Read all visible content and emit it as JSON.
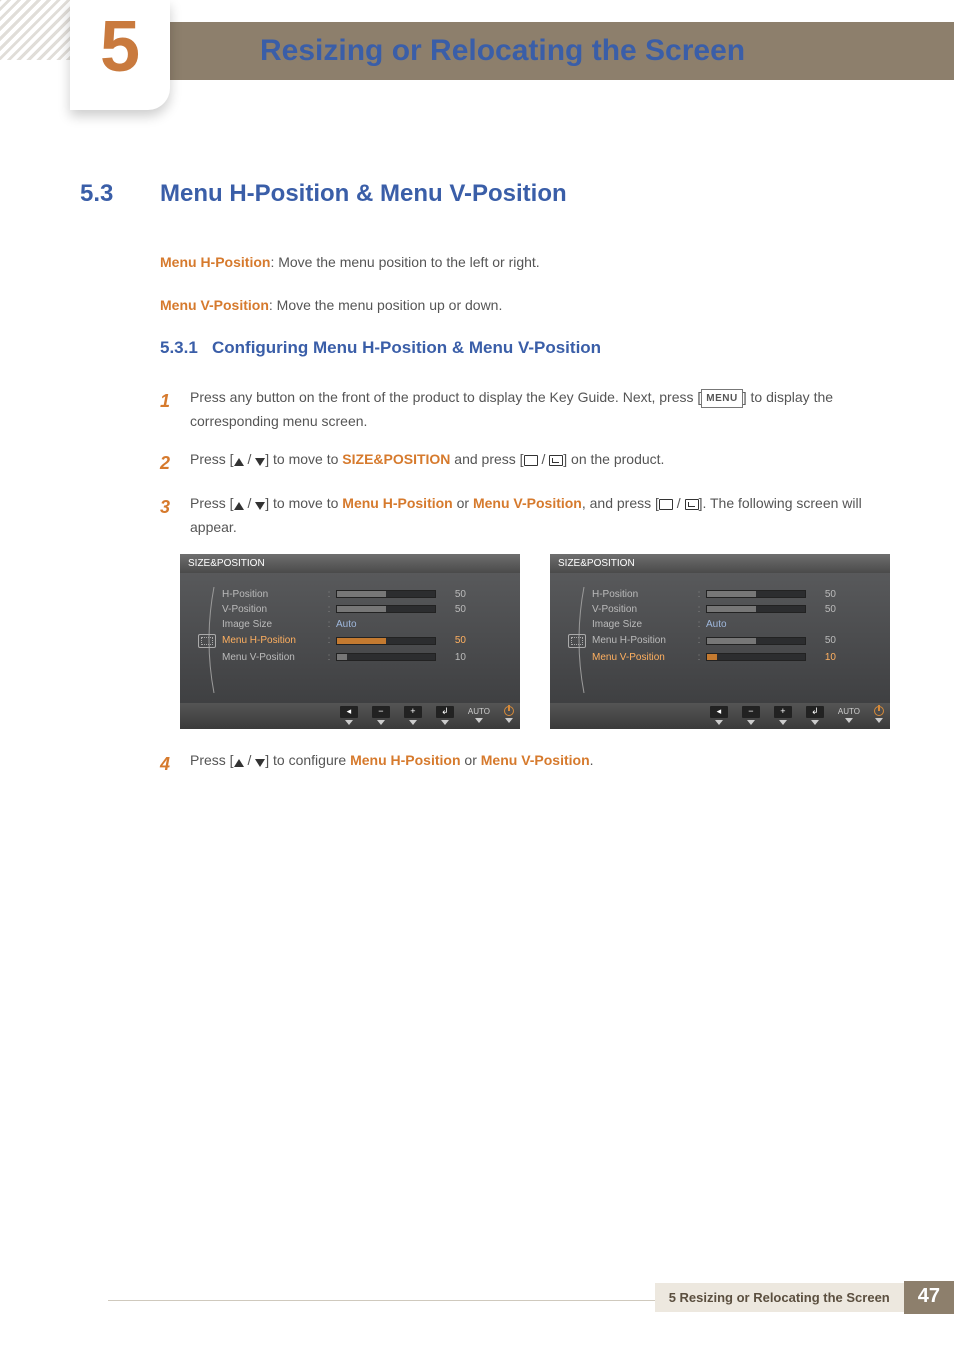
{
  "chapter": {
    "number": "5",
    "title": "Resizing or Relocating the Screen"
  },
  "section": {
    "number": "5.3",
    "title": "Menu H-Position & Menu V-Position"
  },
  "intro": {
    "h_label": "Menu H-Position",
    "h_text": ": Move the menu position to the left or right.",
    "v_label": "Menu V-Position",
    "v_text": ": Move the menu position up or down."
  },
  "subsection": {
    "number": "5.3.1",
    "title": "Configuring Menu H-Position & Menu V-Position"
  },
  "steps": {
    "s1": {
      "n": "1",
      "a": "Press any button on the front of the product to display the Key Guide. Next, press [",
      "menu": "MENU",
      "b": "] to display the corresponding menu screen."
    },
    "s2": {
      "n": "2",
      "a": "Press [",
      "b": "] to move to ",
      "kw": "SIZE&POSITION",
      "c": " and press [",
      "d": "] on the product."
    },
    "s3": {
      "n": "3",
      "a": "Press [",
      "b": "] to move to ",
      "kw1": "Menu H-Position",
      "or": " or ",
      "kw2": "Menu V-Position",
      "c": ", and press [",
      "d": "]. The following screen will appear."
    },
    "s4": {
      "n": "4",
      "a": "Press [",
      "b": "] to configure ",
      "kw1": "Menu H-Position",
      "or": " or ",
      "kw2": "Menu V-Position",
      "c": "."
    }
  },
  "osd": {
    "title": "SIZE&POSITION",
    "items": {
      "hpos": {
        "label": "H-Position",
        "val": "50",
        "fill": 50
      },
      "vpos": {
        "label": "V-Position",
        "val": "50",
        "fill": 50
      },
      "imgsize": {
        "label": "Image Size",
        "val": "Auto"
      },
      "mhpos": {
        "label": "Menu H-Position",
        "val": "50",
        "fill": 50
      },
      "mvpos": {
        "label": "Menu V-Position",
        "val": "10",
        "fill": 10
      }
    },
    "foot": {
      "auto": "AUTO"
    }
  },
  "footer": {
    "text": "5 Resizing or Relocating the Screen",
    "page": "47"
  }
}
